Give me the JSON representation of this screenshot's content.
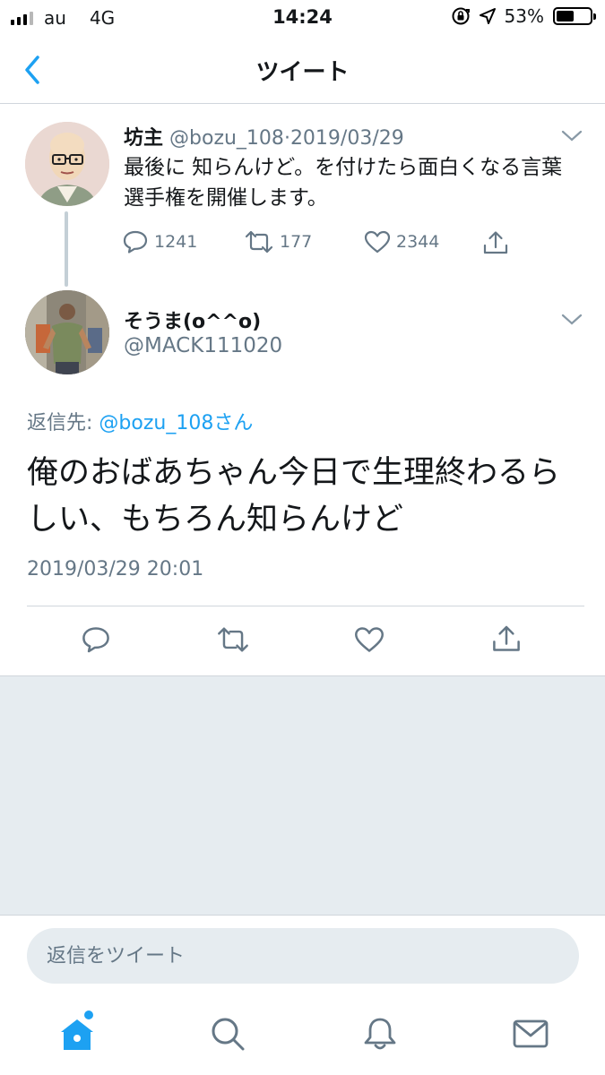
{
  "status_bar": {
    "carrier": "au",
    "network": "4G",
    "time": "14:24",
    "battery": "53%",
    "battery_level": 0.53,
    "icons": [
      "signal-icon",
      "orientation-lock-icon",
      "location-icon",
      "battery-icon"
    ]
  },
  "nav": {
    "title": "ツイート",
    "back_icon": "chevron-left-icon"
  },
  "parent_tweet": {
    "name": "坊主",
    "handle": "@bozu_108",
    "separator": "·",
    "date": "2019/03/29",
    "text": "最後に 知らんけど。を付けたら面白くなる言葉選手権を開催します。",
    "reply_count": "1241",
    "retweet_count": "177",
    "like_count": "2344"
  },
  "reply_tweet": {
    "name": "そうま(o^^o)",
    "handle": "@MACK111020",
    "reply_to_label": "返信先: ",
    "reply_to_link": "@bozu_108さん",
    "text": "俺のおばあちゃん今日で生理終わるらしい、もちろん知らんけど",
    "timestamp": "2019/03/29 20:01"
  },
  "reply_bar": {
    "placeholder": "返信をツイート"
  },
  "tab_bar": {
    "items": [
      "home-icon",
      "search-icon",
      "notifications-icon",
      "messages-icon"
    ]
  },
  "colors": {
    "accent": "#1da1f2",
    "secondary_text": "#657786",
    "primary_text": "#14171a",
    "background_gray": "#e6ecf0"
  }
}
